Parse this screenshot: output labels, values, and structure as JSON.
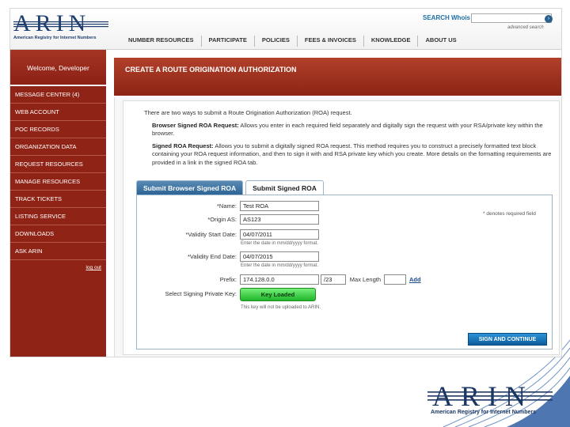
{
  "brand": {
    "logo_text": "ARIN",
    "logo_subtitle": "American Registry for Internet Numbers"
  },
  "search": {
    "label": "SEARCH Whois",
    "value": "",
    "advanced_label": "advanced search"
  },
  "nav": {
    "items": [
      "NUMBER RESOURCES",
      "PARTICIPATE",
      "POLICIES",
      "FEES & INVOICES",
      "KNOWLEDGE",
      "ABOUT US"
    ]
  },
  "sidebar": {
    "welcome": "Welcome, Developer",
    "items": [
      "MESSAGE CENTER (4)",
      "WEB ACCOUNT",
      "POC RECORDS",
      "ORGANIZATION DATA",
      "REQUEST RESOURCES",
      "MANAGE RESOURCES",
      "TRACK TICKETS",
      "LISTING SERVICE",
      "DOWNLOADS",
      "ASK ARIN"
    ],
    "logout": "log out"
  },
  "page": {
    "title": "CREATE A ROUTE ORIGINATION AUTHORIZATION",
    "intro": "There are two ways to submit a Route Origination Authorization (ROA) request.",
    "browser_signed_title": "Browser Signed ROA Request:",
    "browser_signed_text": "Allows you enter in each required field separately and digitally sign the request with your RSA/private key within the browser.",
    "signed_title": "Signed ROA Request:",
    "signed_text": "Allows you to submit a digitally signed ROA request. This method requires you to construct a precisely formatted text block containing your ROA request information, and then to sign it with and RSA private key which you create. More details on the formatting requirements are provided in a link in the signed ROA tab."
  },
  "tabs": {
    "browser": "Submit Browser Signed ROA",
    "signed": "Submit Signed ROA"
  },
  "form": {
    "required_note": "* denotes required field",
    "name_label": "*Name:",
    "name_value": "Test ROA",
    "origin_label": "*Origin AS:",
    "origin_value": "AS123",
    "start_label": "*Validity Start Date:",
    "start_value": "04/07/2011",
    "start_hint": "Enter the date in mm/dd/yyyy format.",
    "end_label": "*Validity End Date:",
    "end_value": "04/07/2015",
    "end_hint": "Enter the date in mm/dd/yyyy format.",
    "prefix_label": "Prefix:",
    "prefix_value": "174.128.0.0",
    "prefix_length": "/23",
    "max_length_label": "Max Length",
    "max_length_value": "",
    "add_label": "Add",
    "key_label": "Select Signing Private Key:",
    "key_button": "Key Loaded",
    "key_hint": "This key will not be uploaded to ARIN.",
    "submit_label": "SIGN AND CONTINUE"
  },
  "footer": {
    "logo_text": "ARIN",
    "logo_subtitle": "American Registry for Internet Numbers"
  },
  "colors": {
    "brand_navy": "#1e3f6e",
    "sidebar_red": "#8f2316",
    "header_red": "#a53424",
    "key_green": "#22b52b",
    "submit_blue": "#0a5c9e"
  }
}
